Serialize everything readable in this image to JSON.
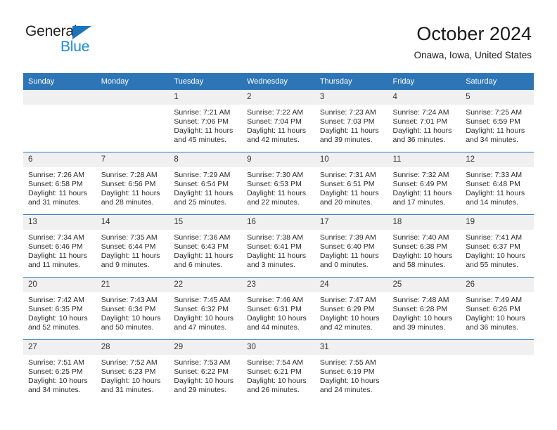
{
  "brand": {
    "name_top": "General",
    "name_bottom": "Blue",
    "accent_color": "#1b8ad6",
    "triangle_color": "#1b75bb"
  },
  "header": {
    "title": "October 2024",
    "subtitle": "Onawa, Iowa, United States",
    "header_bg_color": "#2e75b6",
    "daynum_bg_color": "#f0f0f0"
  },
  "weekday_headers": [
    "Sunday",
    "Monday",
    "Tuesday",
    "Wednesday",
    "Thursday",
    "Friday",
    "Saturday"
  ],
  "labels": {
    "sunrise_prefix": "Sunrise:",
    "sunset_prefix": "Sunset:",
    "daylight_prefix": "Daylight:"
  },
  "weeks": [
    [
      {
        "day": "",
        "empty": true
      },
      {
        "day": "",
        "empty": true
      },
      {
        "day": "1",
        "sunrise": "Sunrise: 7:21 AM",
        "sunset": "Sunset: 7:06 PM",
        "daylight1": "Daylight: 11 hours",
        "daylight2": "and 45 minutes."
      },
      {
        "day": "2",
        "sunrise": "Sunrise: 7:22 AM",
        "sunset": "Sunset: 7:04 PM",
        "daylight1": "Daylight: 11 hours",
        "daylight2": "and 42 minutes."
      },
      {
        "day": "3",
        "sunrise": "Sunrise: 7:23 AM",
        "sunset": "Sunset: 7:03 PM",
        "daylight1": "Daylight: 11 hours",
        "daylight2": "and 39 minutes."
      },
      {
        "day": "4",
        "sunrise": "Sunrise: 7:24 AM",
        "sunset": "Sunset: 7:01 PM",
        "daylight1": "Daylight: 11 hours",
        "daylight2": "and 36 minutes."
      },
      {
        "day": "5",
        "sunrise": "Sunrise: 7:25 AM",
        "sunset": "Sunset: 6:59 PM",
        "daylight1": "Daylight: 11 hours",
        "daylight2": "and 34 minutes."
      }
    ],
    [
      {
        "day": "6",
        "sunrise": "Sunrise: 7:26 AM",
        "sunset": "Sunset: 6:58 PM",
        "daylight1": "Daylight: 11 hours",
        "daylight2": "and 31 minutes."
      },
      {
        "day": "7",
        "sunrise": "Sunrise: 7:28 AM",
        "sunset": "Sunset: 6:56 PM",
        "daylight1": "Daylight: 11 hours",
        "daylight2": "and 28 minutes."
      },
      {
        "day": "8",
        "sunrise": "Sunrise: 7:29 AM",
        "sunset": "Sunset: 6:54 PM",
        "daylight1": "Daylight: 11 hours",
        "daylight2": "and 25 minutes."
      },
      {
        "day": "9",
        "sunrise": "Sunrise: 7:30 AM",
        "sunset": "Sunset: 6:53 PM",
        "daylight1": "Daylight: 11 hours",
        "daylight2": "and 22 minutes."
      },
      {
        "day": "10",
        "sunrise": "Sunrise: 7:31 AM",
        "sunset": "Sunset: 6:51 PM",
        "daylight1": "Daylight: 11 hours",
        "daylight2": "and 20 minutes."
      },
      {
        "day": "11",
        "sunrise": "Sunrise: 7:32 AM",
        "sunset": "Sunset: 6:49 PM",
        "daylight1": "Daylight: 11 hours",
        "daylight2": "and 17 minutes."
      },
      {
        "day": "12",
        "sunrise": "Sunrise: 7:33 AM",
        "sunset": "Sunset: 6:48 PM",
        "daylight1": "Daylight: 11 hours",
        "daylight2": "and 14 minutes."
      }
    ],
    [
      {
        "day": "13",
        "sunrise": "Sunrise: 7:34 AM",
        "sunset": "Sunset: 6:46 PM",
        "daylight1": "Daylight: 11 hours",
        "daylight2": "and 11 minutes."
      },
      {
        "day": "14",
        "sunrise": "Sunrise: 7:35 AM",
        "sunset": "Sunset: 6:44 PM",
        "daylight1": "Daylight: 11 hours",
        "daylight2": "and 9 minutes."
      },
      {
        "day": "15",
        "sunrise": "Sunrise: 7:36 AM",
        "sunset": "Sunset: 6:43 PM",
        "daylight1": "Daylight: 11 hours",
        "daylight2": "and 6 minutes."
      },
      {
        "day": "16",
        "sunrise": "Sunrise: 7:38 AM",
        "sunset": "Sunset: 6:41 PM",
        "daylight1": "Daylight: 11 hours",
        "daylight2": "and 3 minutes."
      },
      {
        "day": "17",
        "sunrise": "Sunrise: 7:39 AM",
        "sunset": "Sunset: 6:40 PM",
        "daylight1": "Daylight: 11 hours",
        "daylight2": "and 0 minutes."
      },
      {
        "day": "18",
        "sunrise": "Sunrise: 7:40 AM",
        "sunset": "Sunset: 6:38 PM",
        "daylight1": "Daylight: 10 hours",
        "daylight2": "and 58 minutes."
      },
      {
        "day": "19",
        "sunrise": "Sunrise: 7:41 AM",
        "sunset": "Sunset: 6:37 PM",
        "daylight1": "Daylight: 10 hours",
        "daylight2": "and 55 minutes."
      }
    ],
    [
      {
        "day": "20",
        "sunrise": "Sunrise: 7:42 AM",
        "sunset": "Sunset: 6:35 PM",
        "daylight1": "Daylight: 10 hours",
        "daylight2": "and 52 minutes."
      },
      {
        "day": "21",
        "sunrise": "Sunrise: 7:43 AM",
        "sunset": "Sunset: 6:34 PM",
        "daylight1": "Daylight: 10 hours",
        "daylight2": "and 50 minutes."
      },
      {
        "day": "22",
        "sunrise": "Sunrise: 7:45 AM",
        "sunset": "Sunset: 6:32 PM",
        "daylight1": "Daylight: 10 hours",
        "daylight2": "and 47 minutes."
      },
      {
        "day": "23",
        "sunrise": "Sunrise: 7:46 AM",
        "sunset": "Sunset: 6:31 PM",
        "daylight1": "Daylight: 10 hours",
        "daylight2": "and 44 minutes."
      },
      {
        "day": "24",
        "sunrise": "Sunrise: 7:47 AM",
        "sunset": "Sunset: 6:29 PM",
        "daylight1": "Daylight: 10 hours",
        "daylight2": "and 42 minutes."
      },
      {
        "day": "25",
        "sunrise": "Sunrise: 7:48 AM",
        "sunset": "Sunset: 6:28 PM",
        "daylight1": "Daylight: 10 hours",
        "daylight2": "and 39 minutes."
      },
      {
        "day": "26",
        "sunrise": "Sunrise: 7:49 AM",
        "sunset": "Sunset: 6:26 PM",
        "daylight1": "Daylight: 10 hours",
        "daylight2": "and 36 minutes."
      }
    ],
    [
      {
        "day": "27",
        "sunrise": "Sunrise: 7:51 AM",
        "sunset": "Sunset: 6:25 PM",
        "daylight1": "Daylight: 10 hours",
        "daylight2": "and 34 minutes."
      },
      {
        "day": "28",
        "sunrise": "Sunrise: 7:52 AM",
        "sunset": "Sunset: 6:23 PM",
        "daylight1": "Daylight: 10 hours",
        "daylight2": "and 31 minutes."
      },
      {
        "day": "29",
        "sunrise": "Sunrise: 7:53 AM",
        "sunset": "Sunset: 6:22 PM",
        "daylight1": "Daylight: 10 hours",
        "daylight2": "and 29 minutes."
      },
      {
        "day": "30",
        "sunrise": "Sunrise: 7:54 AM",
        "sunset": "Sunset: 6:21 PM",
        "daylight1": "Daylight: 10 hours",
        "daylight2": "and 26 minutes."
      },
      {
        "day": "31",
        "sunrise": "Sunrise: 7:55 AM",
        "sunset": "Sunset: 6:19 PM",
        "daylight1": "Daylight: 10 hours",
        "daylight2": "and 24 minutes."
      },
      {
        "day": "",
        "empty": true
      },
      {
        "day": "",
        "empty": true
      }
    ]
  ]
}
